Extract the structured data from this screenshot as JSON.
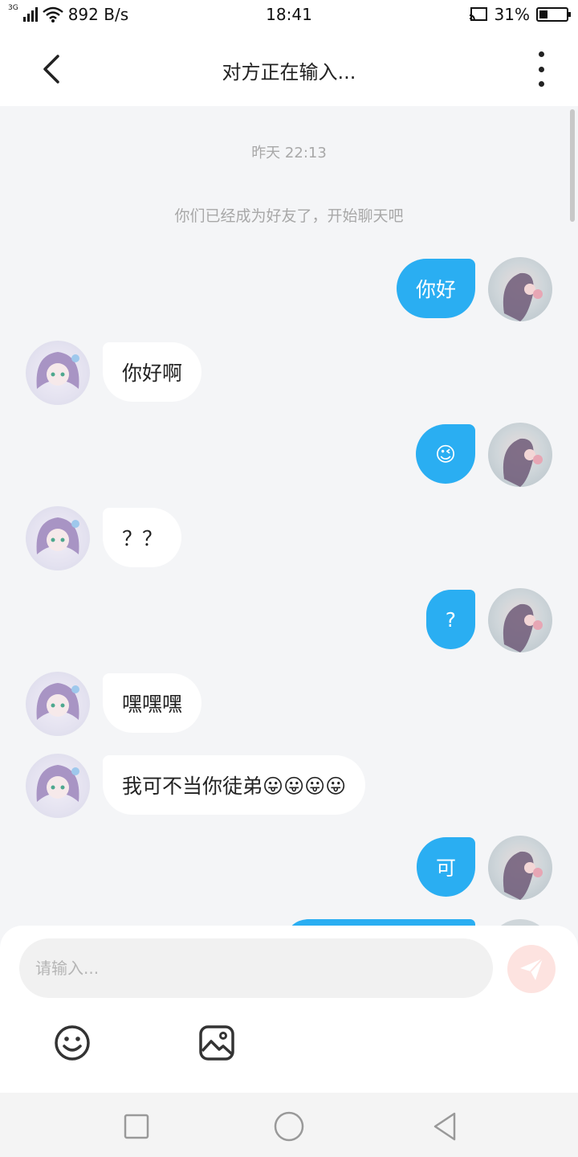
{
  "status_bar": {
    "network_type": "3G",
    "speed": "892 B/s",
    "time": "18:41",
    "battery": "31%",
    "battery_level": 0.31
  },
  "header": {
    "title": "对方正在输入...",
    "back_icon": "chevron-left-icon",
    "more_icon": "more-vertical-icon"
  },
  "chat": {
    "timestamp": "昨天 22:13",
    "system_message": "你们已经成为好友了，开始聊天吧",
    "messages": [
      {
        "from": "me",
        "text": "你好"
      },
      {
        "from": "them",
        "text": "你好啊"
      },
      {
        "from": "me",
        "text": "😉"
      },
      {
        "from": "them",
        "text": "？？"
      },
      {
        "from": "me",
        "text": "?"
      },
      {
        "from": "them",
        "text": "嘿嘿嘿"
      },
      {
        "from": "them",
        "text": "我可不当你徒弟😛😛😛😛"
      },
      {
        "from": "me",
        "text": "可"
      }
    ]
  },
  "composer": {
    "placeholder": "请输入...",
    "send_icon": "paper-plane-icon",
    "emoji_icon": "smiley-icon",
    "image_icon": "image-icon"
  },
  "colors": {
    "accent": "#2aaef2",
    "background": "#f4f5f7",
    "send_disabled": "#fde3e0"
  }
}
